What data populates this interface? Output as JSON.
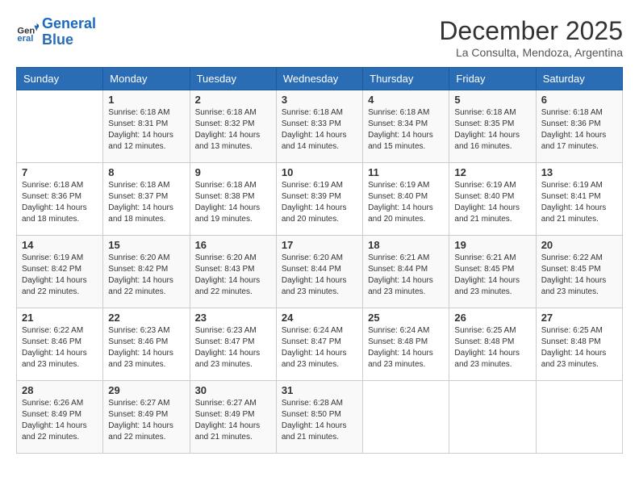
{
  "logo": {
    "line1": "General",
    "line2": "Blue"
  },
  "title": "December 2025",
  "subtitle": "La Consulta, Mendoza, Argentina",
  "headers": [
    "Sunday",
    "Monday",
    "Tuesday",
    "Wednesday",
    "Thursday",
    "Friday",
    "Saturday"
  ],
  "weeks": [
    [
      {
        "day": "",
        "info": ""
      },
      {
        "day": "1",
        "info": "Sunrise: 6:18 AM\nSunset: 8:31 PM\nDaylight: 14 hours\nand 12 minutes."
      },
      {
        "day": "2",
        "info": "Sunrise: 6:18 AM\nSunset: 8:32 PM\nDaylight: 14 hours\nand 13 minutes."
      },
      {
        "day": "3",
        "info": "Sunrise: 6:18 AM\nSunset: 8:33 PM\nDaylight: 14 hours\nand 14 minutes."
      },
      {
        "day": "4",
        "info": "Sunrise: 6:18 AM\nSunset: 8:34 PM\nDaylight: 14 hours\nand 15 minutes."
      },
      {
        "day": "5",
        "info": "Sunrise: 6:18 AM\nSunset: 8:35 PM\nDaylight: 14 hours\nand 16 minutes."
      },
      {
        "day": "6",
        "info": "Sunrise: 6:18 AM\nSunset: 8:36 PM\nDaylight: 14 hours\nand 17 minutes."
      }
    ],
    [
      {
        "day": "7",
        "info": "Sunrise: 6:18 AM\nSunset: 8:36 PM\nDaylight: 14 hours\nand 18 minutes."
      },
      {
        "day": "8",
        "info": "Sunrise: 6:18 AM\nSunset: 8:37 PM\nDaylight: 14 hours\nand 18 minutes."
      },
      {
        "day": "9",
        "info": "Sunrise: 6:18 AM\nSunset: 8:38 PM\nDaylight: 14 hours\nand 19 minutes."
      },
      {
        "day": "10",
        "info": "Sunrise: 6:19 AM\nSunset: 8:39 PM\nDaylight: 14 hours\nand 20 minutes."
      },
      {
        "day": "11",
        "info": "Sunrise: 6:19 AM\nSunset: 8:40 PM\nDaylight: 14 hours\nand 20 minutes."
      },
      {
        "day": "12",
        "info": "Sunrise: 6:19 AM\nSunset: 8:40 PM\nDaylight: 14 hours\nand 21 minutes."
      },
      {
        "day": "13",
        "info": "Sunrise: 6:19 AM\nSunset: 8:41 PM\nDaylight: 14 hours\nand 21 minutes."
      }
    ],
    [
      {
        "day": "14",
        "info": "Sunrise: 6:19 AM\nSunset: 8:42 PM\nDaylight: 14 hours\nand 22 minutes."
      },
      {
        "day": "15",
        "info": "Sunrise: 6:20 AM\nSunset: 8:42 PM\nDaylight: 14 hours\nand 22 minutes."
      },
      {
        "day": "16",
        "info": "Sunrise: 6:20 AM\nSunset: 8:43 PM\nDaylight: 14 hours\nand 22 minutes."
      },
      {
        "day": "17",
        "info": "Sunrise: 6:20 AM\nSunset: 8:44 PM\nDaylight: 14 hours\nand 23 minutes."
      },
      {
        "day": "18",
        "info": "Sunrise: 6:21 AM\nSunset: 8:44 PM\nDaylight: 14 hours\nand 23 minutes."
      },
      {
        "day": "19",
        "info": "Sunrise: 6:21 AM\nSunset: 8:45 PM\nDaylight: 14 hours\nand 23 minutes."
      },
      {
        "day": "20",
        "info": "Sunrise: 6:22 AM\nSunset: 8:45 PM\nDaylight: 14 hours\nand 23 minutes."
      }
    ],
    [
      {
        "day": "21",
        "info": "Sunrise: 6:22 AM\nSunset: 8:46 PM\nDaylight: 14 hours\nand 23 minutes."
      },
      {
        "day": "22",
        "info": "Sunrise: 6:23 AM\nSunset: 8:46 PM\nDaylight: 14 hours\nand 23 minutes."
      },
      {
        "day": "23",
        "info": "Sunrise: 6:23 AM\nSunset: 8:47 PM\nDaylight: 14 hours\nand 23 minutes."
      },
      {
        "day": "24",
        "info": "Sunrise: 6:24 AM\nSunset: 8:47 PM\nDaylight: 14 hours\nand 23 minutes."
      },
      {
        "day": "25",
        "info": "Sunrise: 6:24 AM\nSunset: 8:48 PM\nDaylight: 14 hours\nand 23 minutes."
      },
      {
        "day": "26",
        "info": "Sunrise: 6:25 AM\nSunset: 8:48 PM\nDaylight: 14 hours\nand 23 minutes."
      },
      {
        "day": "27",
        "info": "Sunrise: 6:25 AM\nSunset: 8:48 PM\nDaylight: 14 hours\nand 23 minutes."
      }
    ],
    [
      {
        "day": "28",
        "info": "Sunrise: 6:26 AM\nSunset: 8:49 PM\nDaylight: 14 hours\nand 22 minutes."
      },
      {
        "day": "29",
        "info": "Sunrise: 6:27 AM\nSunset: 8:49 PM\nDaylight: 14 hours\nand 22 minutes."
      },
      {
        "day": "30",
        "info": "Sunrise: 6:27 AM\nSunset: 8:49 PM\nDaylight: 14 hours\nand 21 minutes."
      },
      {
        "day": "31",
        "info": "Sunrise: 6:28 AM\nSunset: 8:50 PM\nDaylight: 14 hours\nand 21 minutes."
      },
      {
        "day": "",
        "info": ""
      },
      {
        "day": "",
        "info": ""
      },
      {
        "day": "",
        "info": ""
      }
    ]
  ]
}
